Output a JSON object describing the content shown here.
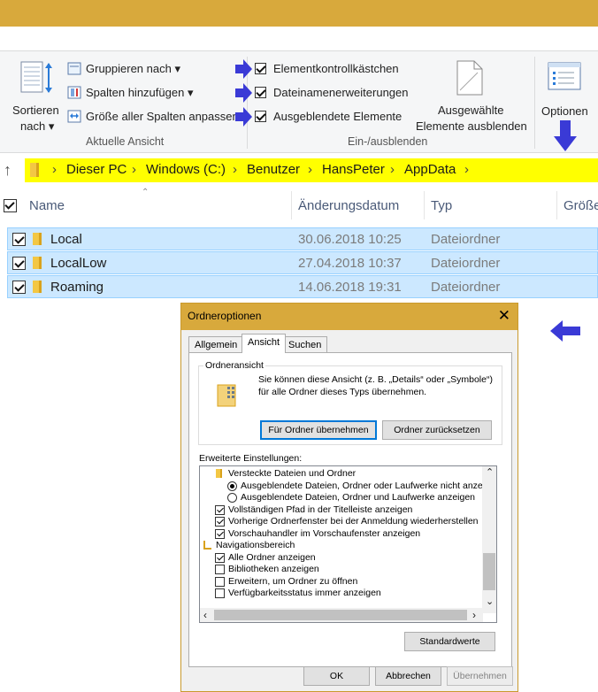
{
  "ribbon": {
    "sort_label_1": "Sortieren",
    "sort_label_2": "nach",
    "group_by": "Gruppieren nach",
    "add_columns": "Spalten hinzufügen",
    "fit_columns": "Größe aller Spalten anpassen",
    "group_current_view": "Aktuelle Ansicht",
    "item_checkboxes": "Elementkontrollkästchen",
    "file_extensions": "Dateinamenerweiterungen",
    "hidden_items": "Ausgeblendete Elemente",
    "hide_selected_1": "Ausgewählte",
    "hide_selected_2": "Elemente ausblenden",
    "group_showhide": "Ein-/ausblenden",
    "options": "Optionen",
    "dropdown_glyph": "▾"
  },
  "address": {
    "crumbs": [
      "Dieser PC",
      "Windows (C:)",
      "Benutzer",
      "HansPeter",
      "AppData"
    ],
    "sep": "›",
    "up_glyph": "↑"
  },
  "columns": {
    "name": "Name",
    "date": "Änderungsdatum",
    "type": "Typ",
    "size": "Größe"
  },
  "rows": [
    {
      "name": "Local",
      "date": "30.06.2018 10:25",
      "type": "Dateiordner"
    },
    {
      "name": "LocalLow",
      "date": "27.04.2018 10:37",
      "type": "Dateiordner"
    },
    {
      "name": "Roaming",
      "date": "14.06.2018 19:31",
      "type": "Dateiordner"
    }
  ],
  "dialog": {
    "title": "Ordneroptionen",
    "close": "✕",
    "tabs": [
      "Allgemein",
      "Ansicht",
      "Suchen"
    ],
    "folder_view_title": "Ordneransicht",
    "folder_view_text_1": "Sie können diese Ansicht (z. B. „Details“ oder „Symbole“)",
    "folder_view_text_2": "für alle Ordner dieses Typs übernehmen.",
    "apply_btn": "Für Ordner übernehmen",
    "reset_btn": "Ordner zurücksetzen",
    "advanced_title": "Erweiterte Einstellungen:",
    "settings": [
      {
        "label": "Versteckte Dateien und Ordner",
        "kind": "folder"
      },
      {
        "label": "Ausgeblendete Dateien, Ordner oder Laufwerke nicht anzeigen",
        "kind": "radio",
        "on": true
      },
      {
        "label": "Ausgeblendete Dateien, Ordner und Laufwerke anzeigen",
        "kind": "radio",
        "on": false
      },
      {
        "label": "Vollständigen Pfad in der Titelleiste anzeigen",
        "kind": "check",
        "on": true
      },
      {
        "label": "Vorherige Ordnerfenster bei der Anmeldung wiederherstellen",
        "kind": "check",
        "on": true
      },
      {
        "label": "Vorschauhandler im Vorschaufenster anzeigen",
        "kind": "check",
        "on": true
      },
      {
        "label": "Navigationsbereich",
        "kind": "nav"
      },
      {
        "label": "Alle Ordner anzeigen",
        "kind": "check",
        "on": true
      },
      {
        "label": "Bibliotheken anzeigen",
        "kind": "check",
        "on": false
      },
      {
        "label": "Erweitern, um Ordner zu öffnen",
        "kind": "check",
        "on": false
      },
      {
        "label": "Verfügbarkeitsstatus immer anzeigen",
        "kind": "check",
        "on": false
      }
    ],
    "defaults_btn": "Standardwerte",
    "ok_btn": "OK",
    "cancel_btn": "Abbrechen",
    "apply_disabled_btn": "Übernehmen",
    "scroll_up": "⌃",
    "scroll_down": "⌄",
    "scroll_left": "‹",
    "scroll_right": "›"
  },
  "colors": {
    "title_bar": "#d8a93c",
    "address_highlight": "#ffff00",
    "selection": "#cce8ff",
    "arrow_blue": "#3a3ad6"
  }
}
